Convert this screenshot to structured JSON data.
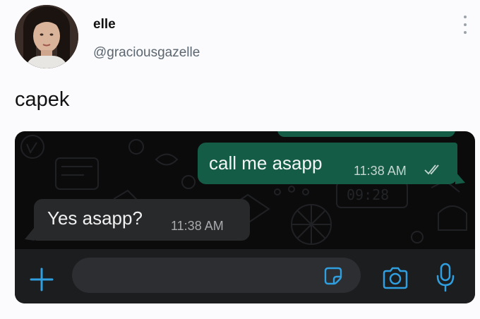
{
  "post": {
    "display_name": "elle",
    "handle": "@graciousgazelle",
    "text": "capek"
  },
  "chat": {
    "outgoing": {
      "text": "call me asapp",
      "time": "11:38 AM",
      "status_icon": "double-check-icon"
    },
    "incoming": {
      "text": "Yes asapp?",
      "time": "11:38 AM"
    }
  },
  "input_bar": {
    "icons": [
      "plus-icon",
      "sticker-icon",
      "camera-icon",
      "microphone-icon"
    ]
  },
  "colors": {
    "accent": "#2f9fe0",
    "outgoing_bubble": "#155c47",
    "incoming_bubble": "#28292b",
    "chat_background": "#0b0b0c"
  }
}
